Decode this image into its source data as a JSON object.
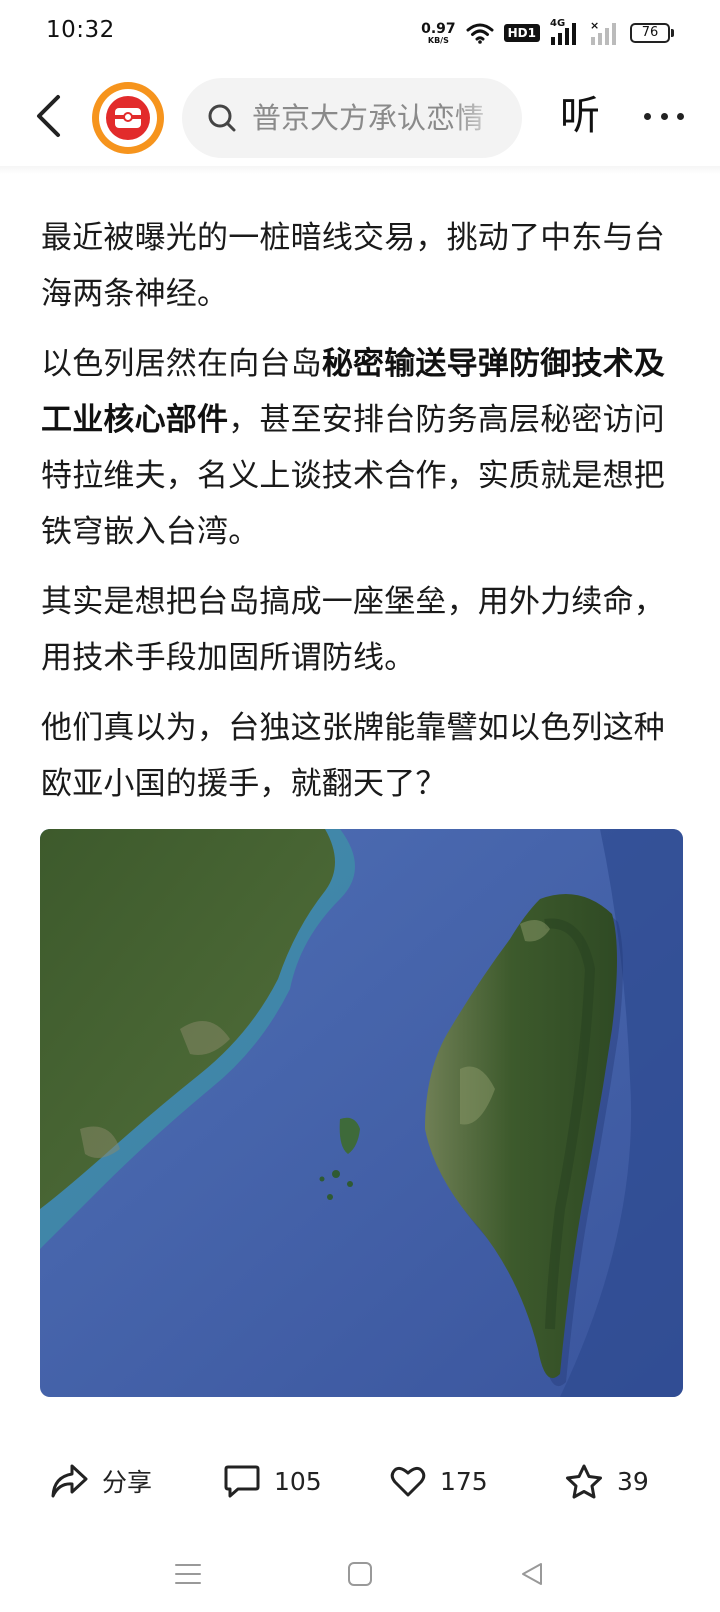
{
  "status_bar": {
    "time": "10:32",
    "net_speed_value": "0.97",
    "net_speed_unit": "KB/S",
    "hd_badge": "HD1",
    "network_type": "4G",
    "battery": "76"
  },
  "header": {
    "search_placeholder": "普京大方承认恋情",
    "listen_label": "听"
  },
  "article": {
    "p1": "最近被曝光的一桩暗线交易，挑动了中东与台海两条神经。",
    "p2_prefix": "以色列居然在向台岛",
    "p2_bold": "秘密输送导弹防御技术及工业核心部件",
    "p2_suffix": "，甚至安排台防务高层秘密访问特拉维夫，名义上谈技术合作，实质就是想把铁穹嵌入台湾。",
    "p3": "其实是想把台岛搞成一座堡垒，用外力续命，用技术手段加固所谓防线。",
    "p4": "他们真以为，台独这张牌能靠譬如以色列这种欧亚小国的援手，就翻天了？"
  },
  "actions": {
    "share_label": "分享",
    "comments_count": "105",
    "likes_count": "175",
    "favorites_count": "39"
  },
  "icons": {
    "back": "back-arrow-icon",
    "search": "search-icon",
    "more": "more-dots-icon",
    "share": "share-icon",
    "comment": "comment-icon",
    "like": "heart-icon",
    "favorite": "star-icon"
  },
  "colors": {
    "logo_ring": "#f6941d",
    "logo_core": "#e22b2b",
    "sea": "#3f5fa6"
  }
}
